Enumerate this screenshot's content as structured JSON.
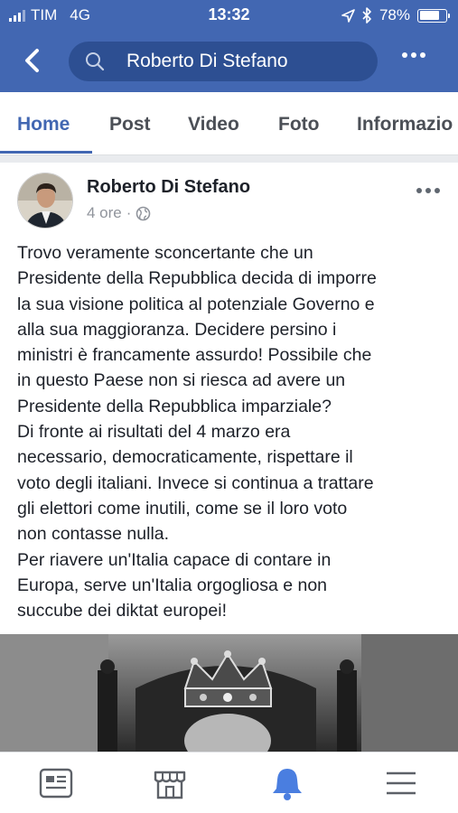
{
  "status_bar": {
    "carrier": "TIM",
    "network": "4G",
    "time": "13:32",
    "battery": "78%",
    "battery_level": 0.78
  },
  "header": {
    "search_text": "Roberto Di Stefano",
    "back_icon": "chevron-left-icon",
    "more_icon": "more-horizontal-icon"
  },
  "tabs": [
    {
      "label": "Home",
      "active": true
    },
    {
      "label": "Post"
    },
    {
      "label": "Video"
    },
    {
      "label": "Foto"
    },
    {
      "label": "Informazio"
    }
  ],
  "post": {
    "author": "Roberto Di Stefano",
    "time": "4 ore",
    "privacy_icon": "globe-icon",
    "text": "Trovo veramente sconcertante che un\nPresidente della Repubblica decida di imporre\nla sua visione politica al potenziale Governo e\nalla sua maggioranza. Decidere persino i\nministri è francamente assurdo! Possibile che\nin questo Paese non si riesca ad avere un\nPresidente della Repubblica imparziale?\nDi fronte ai risultati del 4 marzo era\nnecessario, democraticamente, rispettare il\nvoto degli italiani. Invece si continua a trattare\ngli elettori come inutili, come se il loro voto\nnon contasse nulla.\nPer riavere un'Italia capace di contare in\nEuropa, serve un'Italia orgogliosa e non\nsuccube dei diktat europei!"
  },
  "bottom_nav": [
    {
      "icon": "news-feed-icon"
    },
    {
      "icon": "marketplace-icon"
    },
    {
      "icon": "notifications-bell-icon",
      "active": true
    },
    {
      "icon": "menu-icon"
    }
  ],
  "colors": {
    "brand": "#4267b2",
    "active_icon": "#4a7ee0",
    "inactive_icon": "#5d6168"
  }
}
